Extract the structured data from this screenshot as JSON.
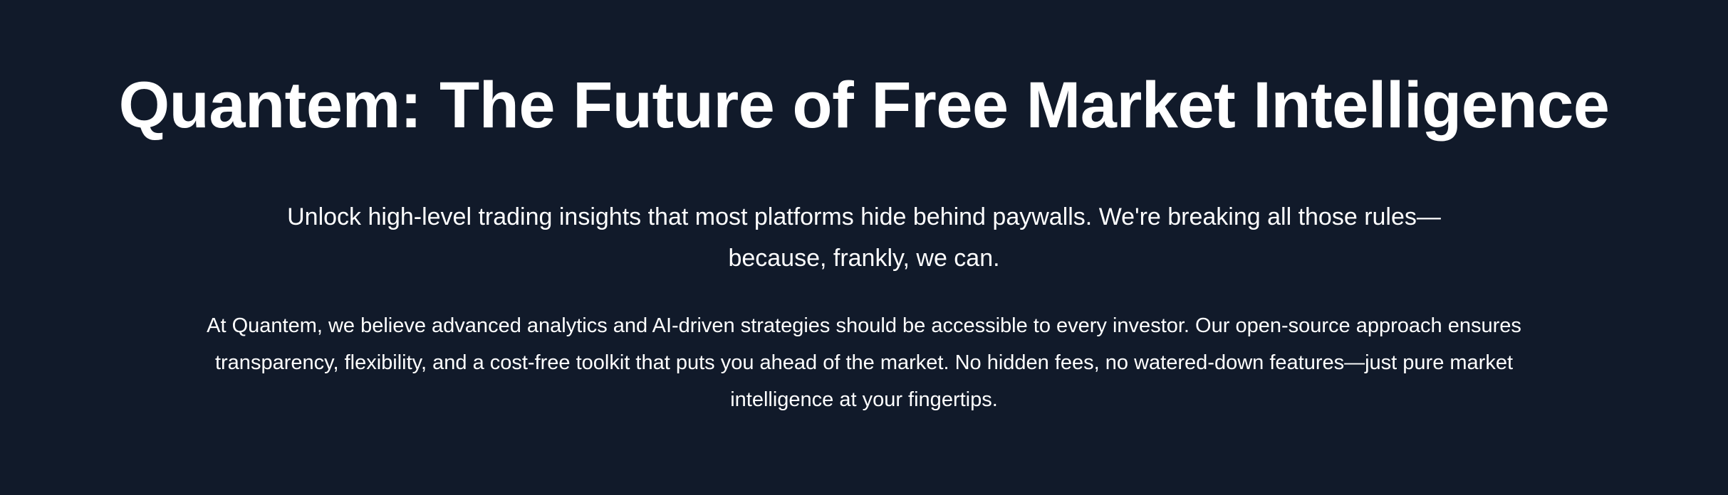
{
  "hero": {
    "title": "Quantem: The Future of Free Market Intelligence",
    "subtitle": "Unlock high-level trading insights that most platforms hide behind paywalls. We're breaking all those rules—because, frankly, we can.",
    "body": "At Quantem, we believe advanced analytics and AI-driven strategies should be accessible to every investor. Our open-source approach ensures transparency, flexibility, and a cost-free toolkit that puts you ahead of the market. No hidden fees, no watered-down features—just pure market intelligence at your fingertips."
  },
  "colors": {
    "background": "#111a2a",
    "text": "#ffffff"
  }
}
